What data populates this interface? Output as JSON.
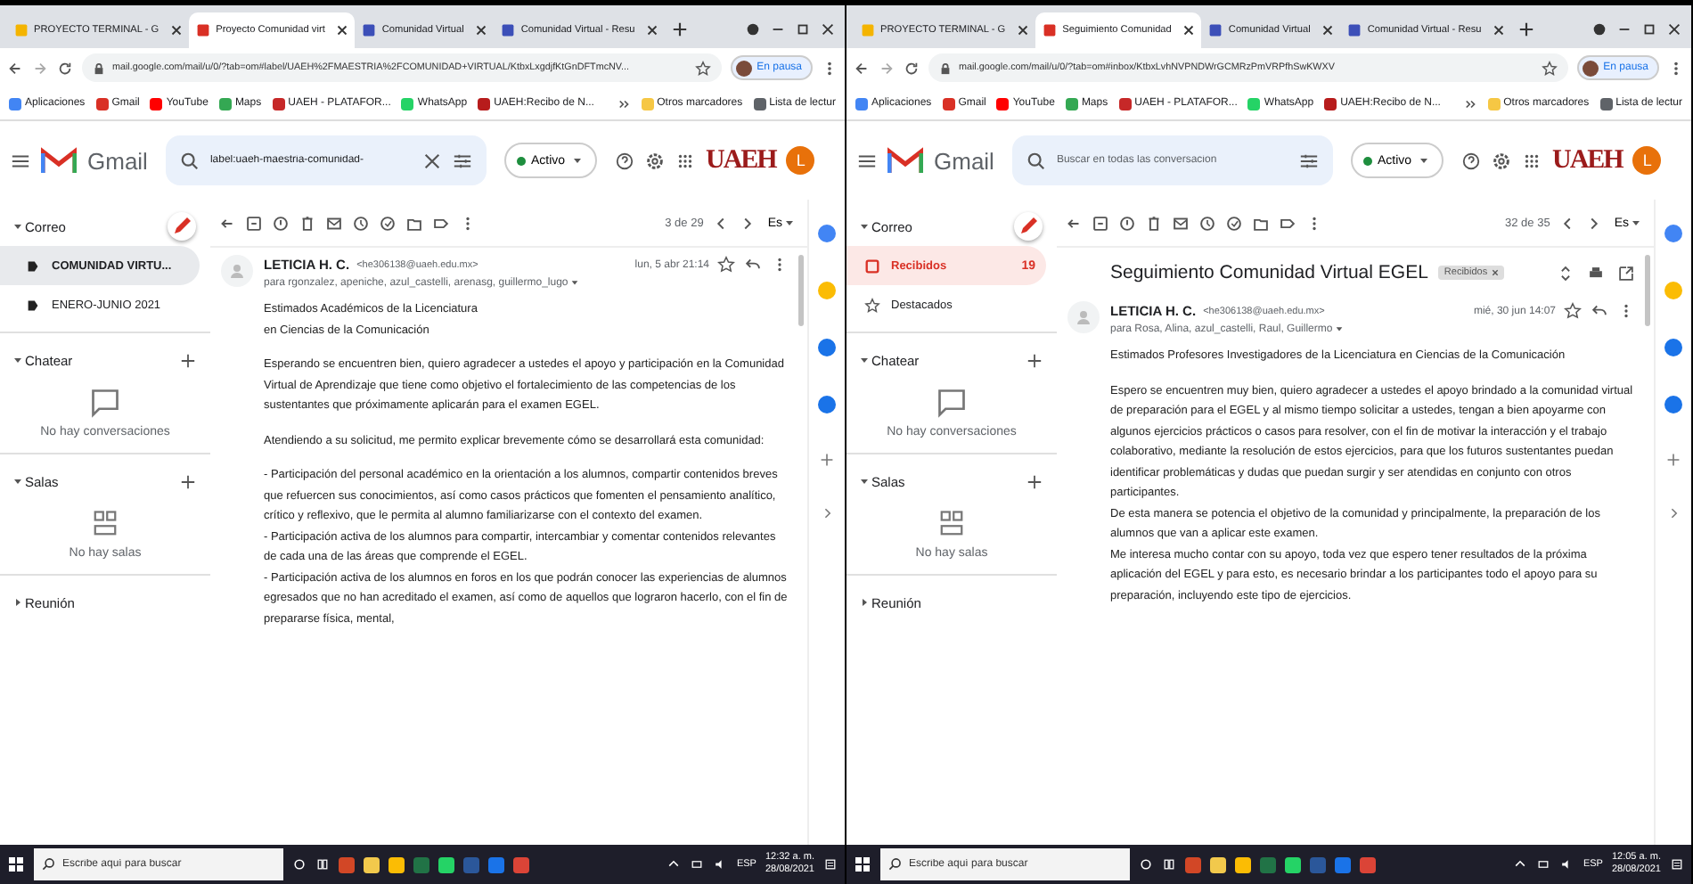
{
  "windows": [
    {
      "tabs": [
        {
          "label": "PROYECTO TERMINAL - G",
          "kind": "drive",
          "selected": false
        },
        {
          "label": "Proyecto Comunidad virt",
          "kind": "gmail",
          "selected": true
        },
        {
          "label": "Comunidad Virtual",
          "kind": "forms",
          "selected": false
        },
        {
          "label": "Comunidad Virtual - Resu",
          "kind": "forms",
          "selected": false
        }
      ],
      "address": "mail.google.com/mail/u/0/?tab=om#label/UAEH%2FMAESTRIA%2FCOMUNIDAD+VIRTUAL/KtbxLxgdjfKtGnDFTmcNV...",
      "profile": "En pausa",
      "bookmarks": [
        {
          "label": "Aplicaciones",
          "kind": "apps"
        },
        {
          "label": "Gmail",
          "kind": "gmail"
        },
        {
          "label": "YouTube",
          "kind": "youtube"
        },
        {
          "label": "Maps",
          "kind": "maps"
        },
        {
          "label": "UAEH - PLATAFOR...",
          "kind": "uaeh"
        },
        {
          "label": "WhatsApp",
          "kind": "whatsapp"
        },
        {
          "label": "UAEH:Recibo de N...",
          "kind": "receipt"
        }
      ],
      "other_bookmarks": "Otros marcadores",
      "reading_list": "Lista de lectur",
      "gmail": {
        "logo": "Gmail",
        "search": {
          "value": "label:uaeh-maestria-comunidad-"
        },
        "status": "Activo",
        "org_logo": "UAEH",
        "avatar": "L"
      },
      "sidebar": {
        "section": "Correo",
        "items": [
          {
            "label": "COMUNIDAD VIRTU...",
            "kind": "label",
            "selected": true
          },
          {
            "label": "ENERO-JUNIO 2021",
            "kind": "label",
            "selected": false
          }
        ],
        "chat": {
          "title": "Chatear",
          "empty": "No hay conversaciones"
        },
        "rooms": {
          "title": "Salas",
          "empty": "No hay salas"
        },
        "meet": "Reunión"
      },
      "toolbar": {
        "counter": "3 de 29",
        "lang": "Es"
      },
      "message": {
        "sender": "LETICIA H. C.",
        "email": "<he306138@uaeh.edu.mx>",
        "recipients": "para rgonzalez, apeniche, azul_castelli, arenasg, guillermo_lugo",
        "date": "lun, 5 abr 21:14",
        "blocks": [
          [
            "Estimados Académicos de la Licenciatura",
            "en Ciencias de la Comunicación"
          ],
          [
            "Esperando se encuentren bien, quiero agradecer a ustedes el apoyo y participación en la Comunidad Virtual de Aprendizaje que tiene como objetivo el fortalecimiento de las competencias de los sustentantes que próximamente aplicarán para el examen EGEL."
          ],
          [
            "Atendiendo a su solicitud, me permito explicar brevemente cómo se desarrollará esta comunidad:"
          ],
          [
            "- Participación del personal académico en la orientación a los alumnos, compartir contenidos breves que refuercen sus conocimientos, así como casos prácticos que fomenten el pensamiento analítico, crítico y reflexivo, que le permita al alumno familiarizarse con el contexto del examen.",
            "- Participación activa de los alumnos para compartir, intercambiar y comentar contenidos relevantes de cada una de las áreas que comprende el EGEL.",
            "- Participación activa de los alumnos en foros en los que podrán conocer las experiencias de alumnos egresados que no han acreditado el examen, así como de aquellos que lograron hacerlo, con el fin de prepararse física, mental,"
          ]
        ]
      },
      "taskbar": {
        "search_placeholder": "Escribe aquí para buscar",
        "lang": "ESP",
        "time": "12:32 a. m.",
        "date": "28/08/2021"
      }
    },
    {
      "tabs": [
        {
          "label": "PROYECTO TERMINAL - G",
          "kind": "drive",
          "selected": false
        },
        {
          "label": "Seguimiento Comunidad",
          "kind": "gmail",
          "selected": true
        },
        {
          "label": "Comunidad Virtual",
          "kind": "forms",
          "selected": false
        },
        {
          "label": "Comunidad Virtual - Resu",
          "kind": "forms",
          "selected": false
        }
      ],
      "address": "mail.google.com/mail/u/0/?tab=om#inbox/KtbxLvhNVPNDWrGCMRzPmVRPfhSwKWXV",
      "profile": "En pausa",
      "bookmarks": [
        {
          "label": "Aplicaciones",
          "kind": "apps"
        },
        {
          "label": "Gmail",
          "kind": "gmail"
        },
        {
          "label": "YouTube",
          "kind": "youtube"
        },
        {
          "label": "Maps",
          "kind": "maps"
        },
        {
          "label": "UAEH - PLATAFOR...",
          "kind": "uaeh"
        },
        {
          "label": "WhatsApp",
          "kind": "whatsapp"
        },
        {
          "label": "UAEH:Recibo de N...",
          "kind": "receipt"
        }
      ],
      "other_bookmarks": "Otros marcadores",
      "reading_list": "Lista de lectur",
      "gmail": {
        "logo": "Gmail",
        "search": {
          "placeholder": "Buscar en todas las conversacion"
        },
        "status": "Activo",
        "org_logo": "UAEH",
        "avatar": "L"
      },
      "sidebar": {
        "section": "Correo",
        "items": [
          {
            "label": "Recibidos",
            "count": "19",
            "kind": "inbox",
            "selected": true
          },
          {
            "label": "Destacados",
            "kind": "star",
            "selected": false
          }
        ],
        "chat": {
          "title": "Chatear",
          "empty": "No hay conversaciones"
        },
        "rooms": {
          "title": "Salas",
          "empty": "No hay salas"
        },
        "meet": "Reunión"
      },
      "toolbar": {
        "counter": "32 de 35",
        "lang": "Es"
      },
      "message": {
        "subject": "Seguimiento Comunidad Virtual EGEL",
        "badge": "Recibidos",
        "sender": "LETICIA H. C.",
        "email": "<he306138@uaeh.edu.mx>",
        "recipients": "para Rosa, Alina, azul_castelli, Raul, Guillermo",
        "date": "mié, 30 jun 14:07",
        "blocks": [
          [
            "Estimados Profesores Investigadores de la Licenciatura en Ciencias de la Comunicación"
          ],
          [
            "Espero se encuentren muy bien, quiero agradecer a ustedes el apoyo brindado a la comunidad virtual de preparación para el EGEL y al mismo tiempo solicitar a ustedes, tengan a bien apoyarme con algunos ejercicios prácticos o casos para resolver, con el fin de motivar la interacción y el trabajo colaborativo, mediante la resolución de estos ejercicios, para que los futuros sustentantes puedan identificar problemáticas y dudas que puedan surgir y ser atendidas en conjunto con otros participantes.",
            "De esta manera se potencia el objetivo de la comunidad y principalmente, la preparación de los alumnos que van a aplicar este examen.",
            "Me interesa mucho contar con su apoyo, toda vez que espero tener resultados de la próxima aplicación del EGEL y para esto, es necesario brindar a los participantes todo el apoyo para su preparación, incluyendo este tipo de ejercicios."
          ]
        ]
      },
      "taskbar": {
        "search_placeholder": "Escribe aquí para buscar",
        "lang": "ESP",
        "time": "12:05 a. m.",
        "date": "28/08/2021"
      }
    }
  ]
}
